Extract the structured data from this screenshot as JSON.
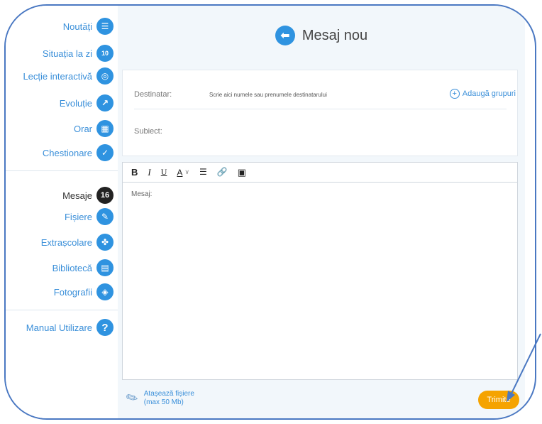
{
  "sidebar": {
    "items": [
      {
        "label": "Noutăți",
        "icon": "news-icon",
        "glyph": "☰"
      },
      {
        "label": "Situația la zi",
        "icon": "grades-icon",
        "glyph": "10"
      },
      {
        "label": "Lecție interactivă",
        "icon": "webcam-icon",
        "glyph": "◎"
      },
      {
        "label": "Evoluție",
        "icon": "trend-icon",
        "glyph": "↗"
      },
      {
        "label": "Orar",
        "icon": "calendar-icon",
        "glyph": "▦"
      },
      {
        "label": "Chestionare",
        "icon": "quiz-icon",
        "glyph": "✓"
      },
      {
        "label": "Mesaje",
        "icon": "messages-count-badge",
        "glyph": "16"
      },
      {
        "label": "Fișiere",
        "icon": "paperclip-icon",
        "glyph": "✎"
      },
      {
        "label": "Extrașcolare",
        "icon": "activities-icon",
        "glyph": "✤"
      },
      {
        "label": "Bibliotecă",
        "icon": "library-icon",
        "glyph": "▤"
      },
      {
        "label": "Fotografii",
        "icon": "photos-icon",
        "glyph": "◈"
      },
      {
        "label": "Manual Utilizare",
        "icon": "help-icon",
        "glyph": "?"
      }
    ]
  },
  "main": {
    "title": "Mesaj nou",
    "recipient_label": "Destinatar:",
    "recipient_placeholder": "Scrie aici numele sau prenumele destinatarului",
    "add_groups": "Adaugă grupuri",
    "subject_label": "Subiect:",
    "message_placeholder": "Mesaj:",
    "toolbar": {
      "bold": "B",
      "italic": "I",
      "underline": "U",
      "text_color": "A",
      "color_caret": "∨",
      "list": "☰",
      "link": "🔗",
      "image": "▣"
    },
    "attach_line1": "Atașează fișiere",
    "attach_line2": "(max 50 Mb)",
    "send": "Trimite"
  },
  "colors": {
    "accent": "#2f93e0",
    "send": "#f5a300",
    "frame": "#4a78c2"
  }
}
